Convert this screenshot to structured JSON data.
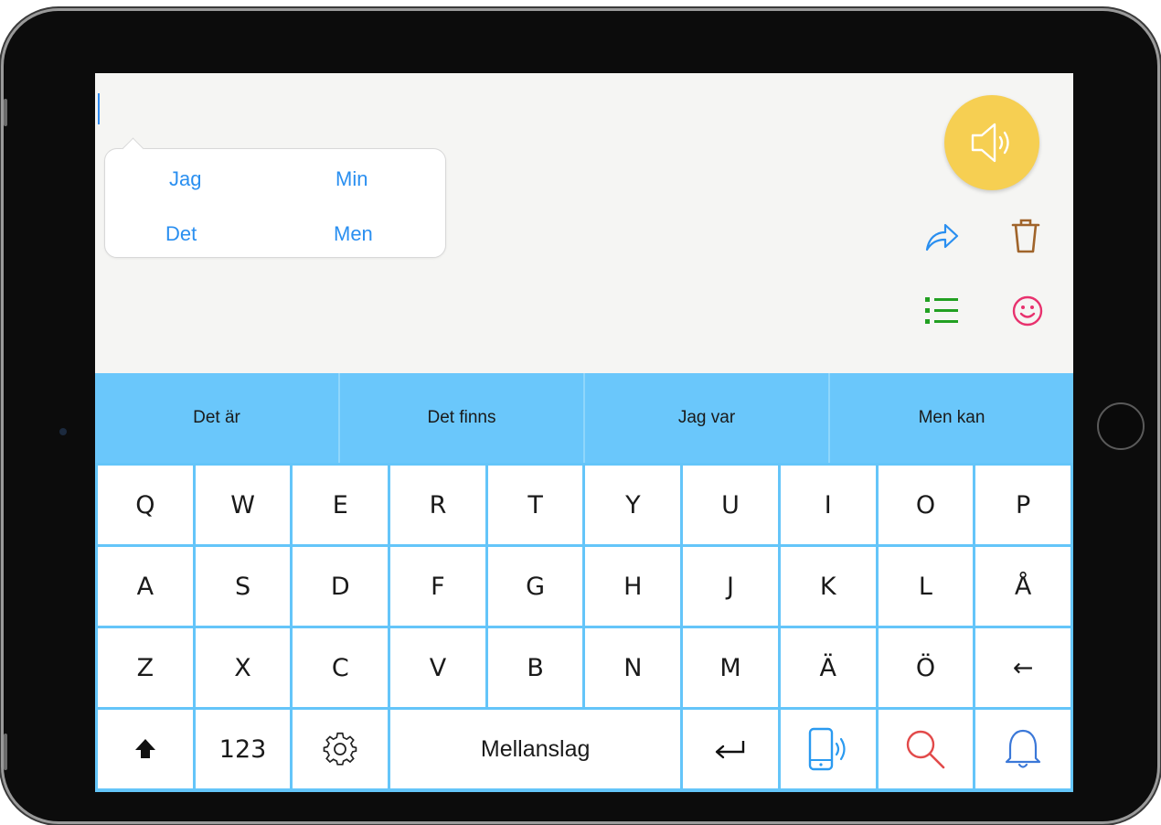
{
  "suggestions": [
    "Jag",
    "Min",
    "Det",
    "Men"
  ],
  "phrases": [
    "Det är",
    "Det finns",
    "Jag var",
    "Men kan"
  ],
  "keyboard": {
    "row1": [
      "Q",
      "W",
      "E",
      "R",
      "T",
      "Y",
      "U",
      "I",
      "O",
      "P"
    ],
    "row2": [
      "A",
      "S",
      "D",
      "F",
      "G",
      "H",
      "J",
      "K",
      "L",
      "Å"
    ],
    "row3": [
      "Z",
      "X",
      "C",
      "V",
      "B",
      "N",
      "M",
      "Ä",
      "Ö",
      "←"
    ],
    "numbers_label": "123",
    "space_label": "Mellanslag"
  },
  "icons": {
    "speak": "speaker-icon",
    "share": "share-arrow-icon",
    "delete": "trash-icon",
    "list": "list-icon",
    "emoji": "smiley-icon",
    "shift": "shift-icon",
    "settings": "gear-icon",
    "enter": "return-icon",
    "phone_speak": "phone-speaker-icon",
    "search": "search-icon",
    "bell": "bell-icon"
  },
  "colors": {
    "accent_blue": "#2a8ff0",
    "keyboard_blue": "#64c5f9",
    "phrase_bar": "#6ac7fb",
    "speak_yellow": "#f6cf52",
    "trash_brown": "#a0642a",
    "list_green": "#22a022",
    "emoji_pink": "#e8326e",
    "search_red": "#e24a4a",
    "bell_blue": "#3b78d8"
  }
}
